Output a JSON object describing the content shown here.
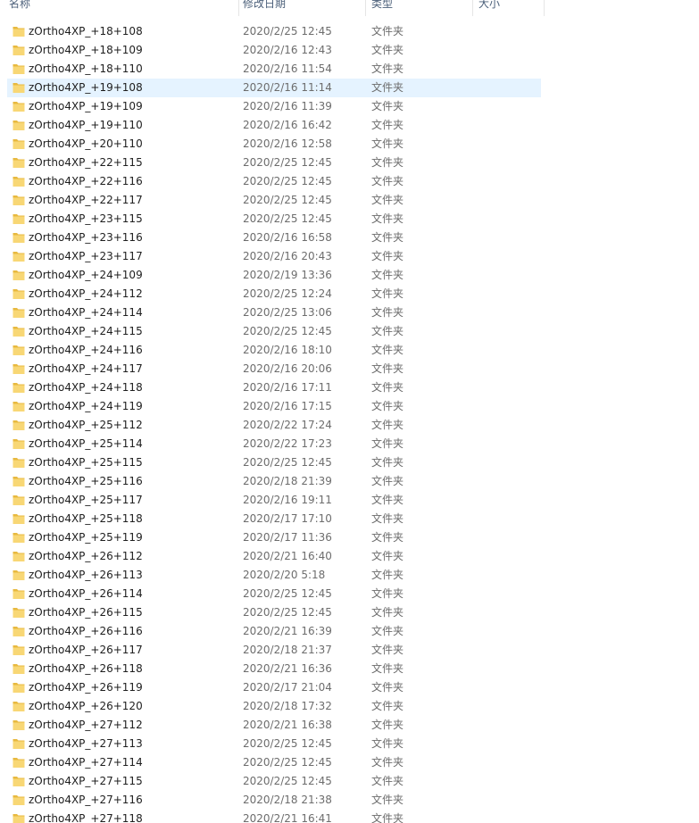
{
  "columns": {
    "name": "名称",
    "date": "修改日期",
    "type": "类型",
    "size": "大小"
  },
  "selected_index": 3,
  "folder_icon_color": "#f8d775",
  "rows": [
    {
      "name": "zOrtho4XP_+18+108",
      "date": "2020/2/25 12:45",
      "type": "文件夹"
    },
    {
      "name": "zOrtho4XP_+18+109",
      "date": "2020/2/16 12:43",
      "type": "文件夹"
    },
    {
      "name": "zOrtho4XP_+18+110",
      "date": "2020/2/16 11:54",
      "type": "文件夹"
    },
    {
      "name": "zOrtho4XP_+19+108",
      "date": "2020/2/16 11:14",
      "type": "文件夹"
    },
    {
      "name": "zOrtho4XP_+19+109",
      "date": "2020/2/16 11:39",
      "type": "文件夹"
    },
    {
      "name": "zOrtho4XP_+19+110",
      "date": "2020/2/16 16:42",
      "type": "文件夹"
    },
    {
      "name": "zOrtho4XP_+20+110",
      "date": "2020/2/16 12:58",
      "type": "文件夹"
    },
    {
      "name": "zOrtho4XP_+22+115",
      "date": "2020/2/25 12:45",
      "type": "文件夹"
    },
    {
      "name": "zOrtho4XP_+22+116",
      "date": "2020/2/25 12:45",
      "type": "文件夹"
    },
    {
      "name": "zOrtho4XP_+22+117",
      "date": "2020/2/25 12:45",
      "type": "文件夹"
    },
    {
      "name": "zOrtho4XP_+23+115",
      "date": "2020/2/25 12:45",
      "type": "文件夹"
    },
    {
      "name": "zOrtho4XP_+23+116",
      "date": "2020/2/16 16:58",
      "type": "文件夹"
    },
    {
      "name": "zOrtho4XP_+23+117",
      "date": "2020/2/16 20:43",
      "type": "文件夹"
    },
    {
      "name": "zOrtho4XP_+24+109",
      "date": "2020/2/19 13:36",
      "type": "文件夹"
    },
    {
      "name": "zOrtho4XP_+24+112",
      "date": "2020/2/25 12:24",
      "type": "文件夹"
    },
    {
      "name": "zOrtho4XP_+24+114",
      "date": "2020/2/25 13:06",
      "type": "文件夹"
    },
    {
      "name": "zOrtho4XP_+24+115",
      "date": "2020/2/25 12:45",
      "type": "文件夹"
    },
    {
      "name": "zOrtho4XP_+24+116",
      "date": "2020/2/16 18:10",
      "type": "文件夹"
    },
    {
      "name": "zOrtho4XP_+24+117",
      "date": "2020/2/16 20:06",
      "type": "文件夹"
    },
    {
      "name": "zOrtho4XP_+24+118",
      "date": "2020/2/16 17:11",
      "type": "文件夹"
    },
    {
      "name": "zOrtho4XP_+24+119",
      "date": "2020/2/16 17:15",
      "type": "文件夹"
    },
    {
      "name": "zOrtho4XP_+25+112",
      "date": "2020/2/22 17:24",
      "type": "文件夹"
    },
    {
      "name": "zOrtho4XP_+25+114",
      "date": "2020/2/22 17:23",
      "type": "文件夹"
    },
    {
      "name": "zOrtho4XP_+25+115",
      "date": "2020/2/25 12:45",
      "type": "文件夹"
    },
    {
      "name": "zOrtho4XP_+25+116",
      "date": "2020/2/18 21:39",
      "type": "文件夹"
    },
    {
      "name": "zOrtho4XP_+25+117",
      "date": "2020/2/16 19:11",
      "type": "文件夹"
    },
    {
      "name": "zOrtho4XP_+25+118",
      "date": "2020/2/17 17:10",
      "type": "文件夹"
    },
    {
      "name": "zOrtho4XP_+25+119",
      "date": "2020/2/17 11:36",
      "type": "文件夹"
    },
    {
      "name": "zOrtho4XP_+26+112",
      "date": "2020/2/21 16:40",
      "type": "文件夹"
    },
    {
      "name": "zOrtho4XP_+26+113",
      "date": "2020/2/20 5:18",
      "type": "文件夹"
    },
    {
      "name": "zOrtho4XP_+26+114",
      "date": "2020/2/25 12:45",
      "type": "文件夹"
    },
    {
      "name": "zOrtho4XP_+26+115",
      "date": "2020/2/25 12:45",
      "type": "文件夹"
    },
    {
      "name": "zOrtho4XP_+26+116",
      "date": "2020/2/21 16:39",
      "type": "文件夹"
    },
    {
      "name": "zOrtho4XP_+26+117",
      "date": "2020/2/18 21:37",
      "type": "文件夹"
    },
    {
      "name": "zOrtho4XP_+26+118",
      "date": "2020/2/21 16:36",
      "type": "文件夹"
    },
    {
      "name": "zOrtho4XP_+26+119",
      "date": "2020/2/17 21:04",
      "type": "文件夹"
    },
    {
      "name": "zOrtho4XP_+26+120",
      "date": "2020/2/18 17:32",
      "type": "文件夹"
    },
    {
      "name": "zOrtho4XP_+27+112",
      "date": "2020/2/21 16:38",
      "type": "文件夹"
    },
    {
      "name": "zOrtho4XP_+27+113",
      "date": "2020/2/25 12:45",
      "type": "文件夹"
    },
    {
      "name": "zOrtho4XP_+27+114",
      "date": "2020/2/25 12:45",
      "type": "文件夹"
    },
    {
      "name": "zOrtho4XP_+27+115",
      "date": "2020/2/25 12:45",
      "type": "文件夹"
    },
    {
      "name": "zOrtho4XP_+27+116",
      "date": "2020/2/18 21:38",
      "type": "文件夹"
    },
    {
      "name": "zOrtho4XP_+27+118",
      "date": "2020/2/21 16:41",
      "type": "文件夹"
    }
  ]
}
